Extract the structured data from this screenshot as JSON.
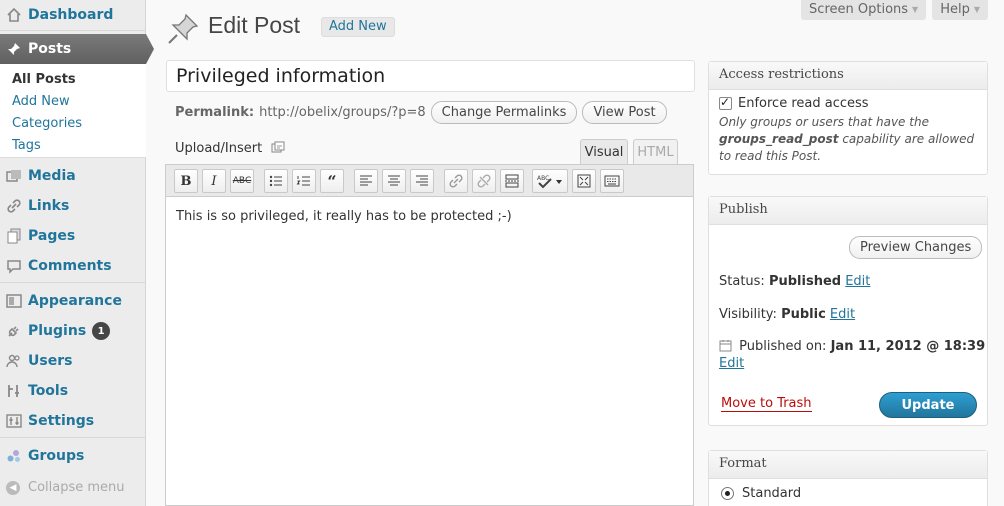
{
  "sidebar": {
    "dashboard": "Dashboard",
    "posts": "Posts",
    "submenu": [
      "All Posts",
      "Add New",
      "Categories",
      "Tags"
    ],
    "media": "Media",
    "links": "Links",
    "pages": "Pages",
    "comments": "Comments",
    "appearance": "Appearance",
    "plugins": "Plugins",
    "plugins_badge": "1",
    "users": "Users",
    "tools": "Tools",
    "settings": "Settings",
    "groups": "Groups",
    "collapse": "Collapse menu"
  },
  "header": {
    "title": "Edit Post",
    "add_new": "Add New",
    "screen_options": "Screen Options",
    "help": "Help"
  },
  "post": {
    "title": "Privileged information",
    "permalink_label": "Permalink:",
    "permalink_url": "http://obelix/groups/?p=8",
    "change_permalinks": "Change Permalinks",
    "view_post": "View Post",
    "upload_insert": "Upload/Insert",
    "tab_visual": "Visual",
    "tab_html": "HTML",
    "content": "This is so privileged, it really has to be protected ;-)"
  },
  "access": {
    "title": "Access restrictions",
    "checkbox_label": "Enforce read access",
    "desc_1": "Only groups or users that have the",
    "desc_cap": "groups_read_post",
    "desc_2": "capability are allowed to read this Post."
  },
  "publish": {
    "title": "Publish",
    "preview": "Preview Changes",
    "status_label": "Status:",
    "status_value": "Published",
    "visibility_label": "Visibility:",
    "visibility_value": "Public",
    "edit": "Edit",
    "published_on_label": "Published on:",
    "published_on_value": "Jan 11, 2012 @ 18:39",
    "move_to_trash": "Move to Trash",
    "update": "Update"
  },
  "format": {
    "title": "Format",
    "option": "Standard"
  }
}
